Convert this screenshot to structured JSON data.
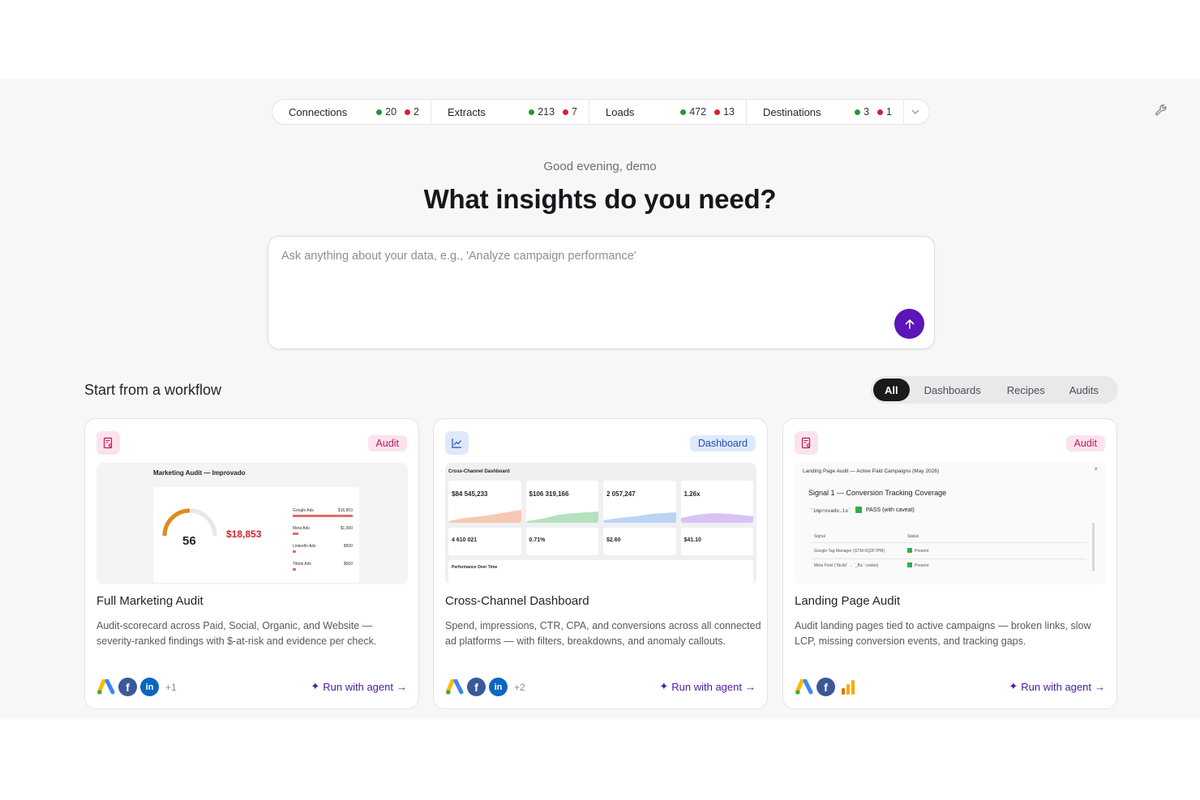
{
  "status_bar": {
    "segments": [
      {
        "label": "Connections",
        "ok": "20",
        "err": "2"
      },
      {
        "label": "Extracts",
        "ok": "213",
        "err": "7"
      },
      {
        "label": "Loads",
        "ok": "472",
        "err": "13"
      },
      {
        "label": "Destinations",
        "ok": "3",
        "err": "1"
      }
    ]
  },
  "greeting": "Good evening, demo",
  "headline": "What insights do you need?",
  "ask": {
    "placeholder": "Ask anything about your data, e.g., 'Analyze campaign performance'"
  },
  "workflows": {
    "title": "Start from a workflow",
    "filters": [
      "All",
      "Dashboards",
      "Recipes",
      "Audits"
    ],
    "active_filter": "All"
  },
  "cards": [
    {
      "badge": "Audit",
      "title": "Full Marketing Audit",
      "description": "Audit-scorecard across Paid, Social, Organic, and Website — severity-ranked findings with $-at-risk and evidence per check.",
      "more": "+1",
      "run": "Run with agent",
      "thumb": {
        "title": "Marketing Audit — Improvado",
        "score": "56",
        "money": "$18,853",
        "rows": [
          "Google Ads",
          "Meta Ads",
          "LinkedIn Ads",
          "Tiktok Ads"
        ],
        "row_values": [
          "$16,853",
          "$1,000",
          "$500",
          "$500"
        ]
      }
    },
    {
      "badge": "Dashboard",
      "title": "Cross-Channel Dashboard",
      "description": "Spend, impressions, CTR, CPA, and conversions across all connected ad platforms — with filters, breakdowns, and anomaly callouts.",
      "more": "+2",
      "run": "Run with agent",
      "thumb": {
        "title": "Cross-Channel Dashboard",
        "kpis": [
          "$84 545,233",
          "$106 319,166",
          "2 057,247",
          "1.26x"
        ],
        "kpis2": [
          "4 610 021",
          "0.71%",
          "$2.60",
          "$41.10"
        ],
        "section": "Performance Over Time"
      }
    },
    {
      "badge": "Audit",
      "title": "Landing Page Audit",
      "description": "Audit landing pages tied to active campaigns — broken links, slow LCP, missing conversion events, and tracking gaps.",
      "more": "",
      "run": "Run with agent",
      "thumb": {
        "title": "Landing Page Audit — Active Paid Campaigns (May 2026)",
        "signal": "Signal 1 — Conversion Tracking Coverage",
        "domain": "`improvado.io`",
        "pass": "PASS (with caveat)",
        "col1": "Signal",
        "col2": "Status",
        "rows": [
          "Google Tag Manager (GTM-5Q2F7PM)",
          "Meta Pixel (`fbclid` → `_fbc` cookie)"
        ],
        "status": [
          "Present",
          "Present"
        ]
      }
    }
  ]
}
